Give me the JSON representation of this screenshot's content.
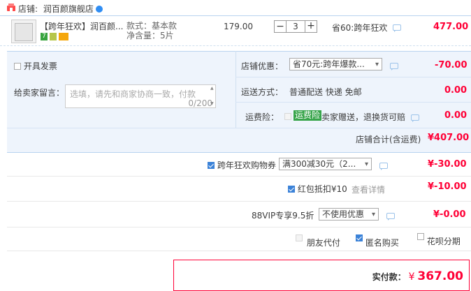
{
  "shop": {
    "label": "店铺:",
    "name": "润百颜旗舰店"
  },
  "item": {
    "title": "【跨年狂欢】润百颜...",
    "badge1": "7",
    "spec_label": "款式：基本款",
    "spec_qty": "净含量：5片",
    "unit_price": "179.00",
    "quantity": "3",
    "minus": "−",
    "plus": "+",
    "discount": "省60:跨年狂欢",
    "subtotal": "477.00"
  },
  "invoice": {
    "label": "开具发票"
  },
  "shop_coupon": {
    "label": "店铺优惠：",
    "value": "省70元:跨年爆款...",
    "amount": "-70.00"
  },
  "message": {
    "label": "给卖家留言：",
    "placeholder": "选填，请先和商家协商一致，付款",
    "counter": "0/200"
  },
  "shipping": {
    "label": "运送方式：",
    "value": "普通配送 快递 免邮",
    "amount": "0.00"
  },
  "freight_insurance": {
    "label": "运费险：",
    "tag": "运费险",
    "desc": "卖家赠送，退换货可赔",
    "amount": "0.00"
  },
  "shop_total": {
    "label": "店铺合计(含运费)",
    "value": "¥407.00"
  },
  "platform_coupon": {
    "label": "跨年狂欢购物券",
    "value": "满300减30元（2...",
    "amount": "¥-30.00"
  },
  "red_packet": {
    "label": "红包抵扣¥10",
    "link": "查看详情",
    "amount": "¥-10.00"
  },
  "vip": {
    "label": "88VIP专享9.5折",
    "value": "不使用优惠",
    "amount": "¥-0.00"
  },
  "options": {
    "friend_pay": "朋友代付",
    "anonymous": "匿名购买",
    "huabei": "花呗分期"
  },
  "final": {
    "label": "实付款：",
    "currency": "¥",
    "amount": "367.00"
  },
  "colors": {
    "accent_red": "#ff0036",
    "panel_blue": "#eef4fc",
    "tag_green": "#37a44a"
  }
}
